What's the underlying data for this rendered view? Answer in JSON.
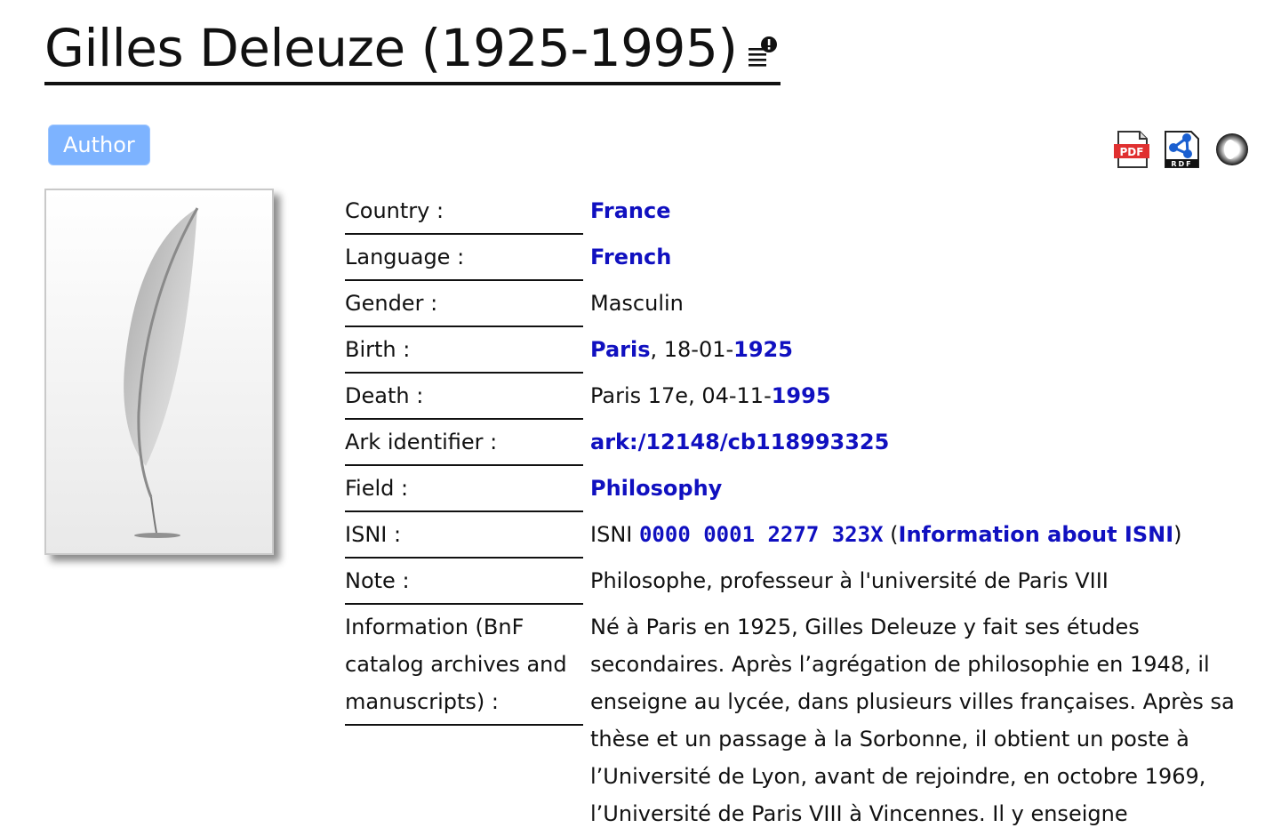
{
  "title": "Gilles Deleuze (1925-1995)",
  "badge": "Author",
  "icons": {
    "title": "document-info-icon",
    "pdf": "pdf-icon",
    "rdf": "rdf-icon",
    "ring": "circle-link-icon",
    "portrait": "quill-pen-icon"
  },
  "labels": {
    "pdf": "PDF",
    "rdf": "RDF"
  },
  "colors": {
    "link": "#1010c0",
    "badge": "#7db3ff",
    "pdf": "#e03030"
  },
  "info": {
    "country": {
      "label": "Country :",
      "value": "France"
    },
    "language": {
      "label": "Language :",
      "value": "French"
    },
    "gender": {
      "label": "Gender :",
      "value": "Masculin"
    },
    "birth": {
      "label": "Birth :",
      "place": "Paris",
      "mid": ", 18-01-",
      "year": "1925"
    },
    "death": {
      "label": "Death :",
      "text": "Paris 17e, 04-11-",
      "year": "1995"
    },
    "ark": {
      "label": "Ark identifier :",
      "value": "ark:/12148/cb118993325"
    },
    "field": {
      "label": "Field :",
      "value": "Philosophy"
    },
    "isni": {
      "label": "ISNI :",
      "prefix": "ISNI ",
      "number": "0000 0001 2277 323X",
      "open": " (",
      "about": "Information about ISNI",
      "close": ")"
    },
    "note": {
      "label": "Note :",
      "value": "Philosophe, professeur à l'université de Paris VIII"
    },
    "information": {
      "label": "Information (BnF catalog archives and manuscripts) :",
      "value": "Né à Paris en 1925, Gilles Deleuze y fait ses études secondaires. Après l’agrégation de philosophie en 1948, il enseigne au lycée, dans plusieurs villes françaises. Après sa thèse et un passage à la Sorbonne, il obtient un poste à l’Université de Lyon, avant de rejoindre, en octobre 1969, l’Université de Paris VIII à Vincennes. Il y enseigne"
    }
  }
}
